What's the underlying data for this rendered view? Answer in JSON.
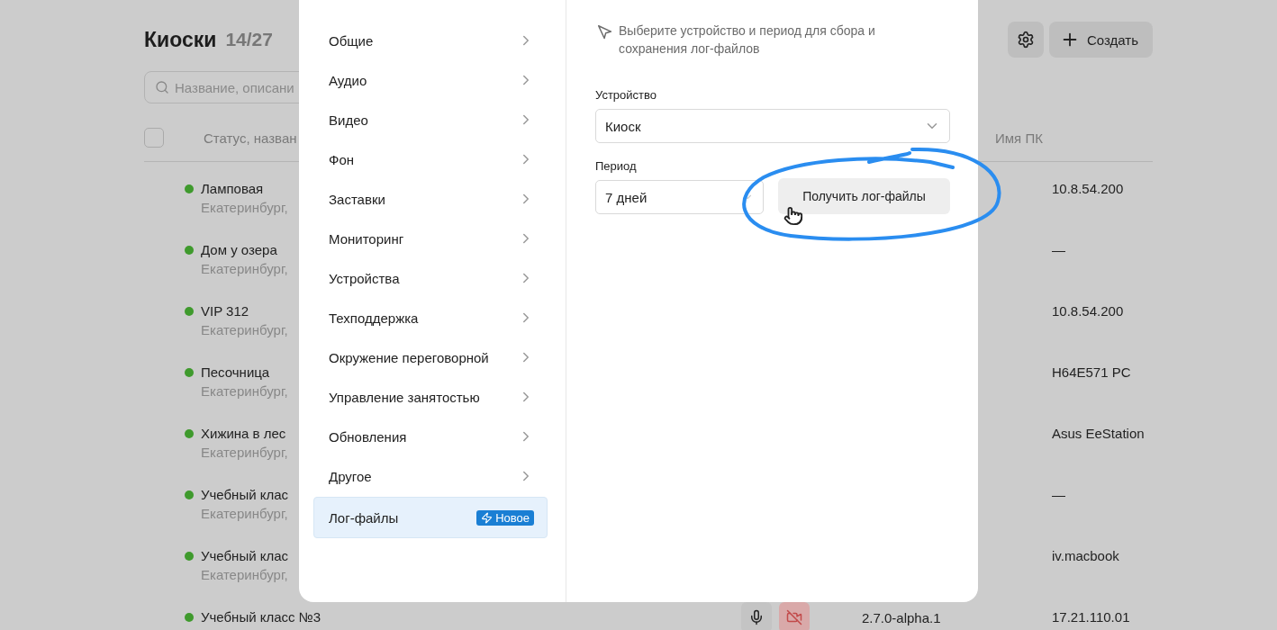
{
  "page": {
    "title": "Киоски",
    "count": "14/27",
    "search": {
      "placeholder": "Название, описани"
    },
    "create_button": "Создать"
  },
  "table": {
    "select_all": {
      "checked": false
    },
    "columns": [
      "Статус, назван",
      "Имя ПК"
    ],
    "rows": [
      {
        "name": "Ламповая",
        "address": "Екатеринбург,",
        "pc": "10.8.54.200"
      },
      {
        "name": "Дом у озера",
        "address": "Екатеринбург,",
        "pc": "—"
      },
      {
        "name": "VIP 312",
        "address": "Екатеринбург,",
        "pc": "10.8.54.200"
      },
      {
        "name": "Песочница",
        "address": "Екатеринбург,",
        "pc": "H64E571 PC"
      },
      {
        "name": "Хижина в лес",
        "address": "Екатеринбург,",
        "pc": "Asus EeStation"
      },
      {
        "name": "Учебный клас",
        "address": "Екатеринбург,",
        "pc": "—"
      },
      {
        "name": "Учебный клас",
        "address": "Екатеринбург,",
        "pc": "iv.macbook"
      },
      {
        "name": "Учебный класс №3",
        "pc": "17.21.110.01",
        "version": "2.7.0-alpha.1",
        "camera_off": true
      }
    ]
  },
  "modal": {
    "nav": [
      {
        "label": "Общие",
        "selected": false
      },
      {
        "label": "Аудио",
        "selected": false
      },
      {
        "label": "Видео",
        "selected": false
      },
      {
        "label": "Фон",
        "selected": false
      },
      {
        "label": "Заставки",
        "selected": false
      },
      {
        "label": "Мониторинг",
        "selected": false
      },
      {
        "label": "Устройства",
        "selected": false
      },
      {
        "label": "Техподдержка",
        "selected": false
      },
      {
        "label": "Окружение переговорной",
        "selected": false
      },
      {
        "label": "Управление занятостью",
        "selected": false
      },
      {
        "label": "Обновления",
        "selected": false
      },
      {
        "label": "Другое",
        "selected": false
      },
      {
        "label": "Лог-файлы",
        "selected": true,
        "badge": "Новое"
      }
    ],
    "hint": "Выберите устройство и период для сбора и сохранения лог-файлов",
    "device": {
      "label": "Устройство",
      "value": "Киоск"
    },
    "period": {
      "label": "Период",
      "value": "7 дней"
    },
    "action_button": "Получить лог-файлы"
  }
}
